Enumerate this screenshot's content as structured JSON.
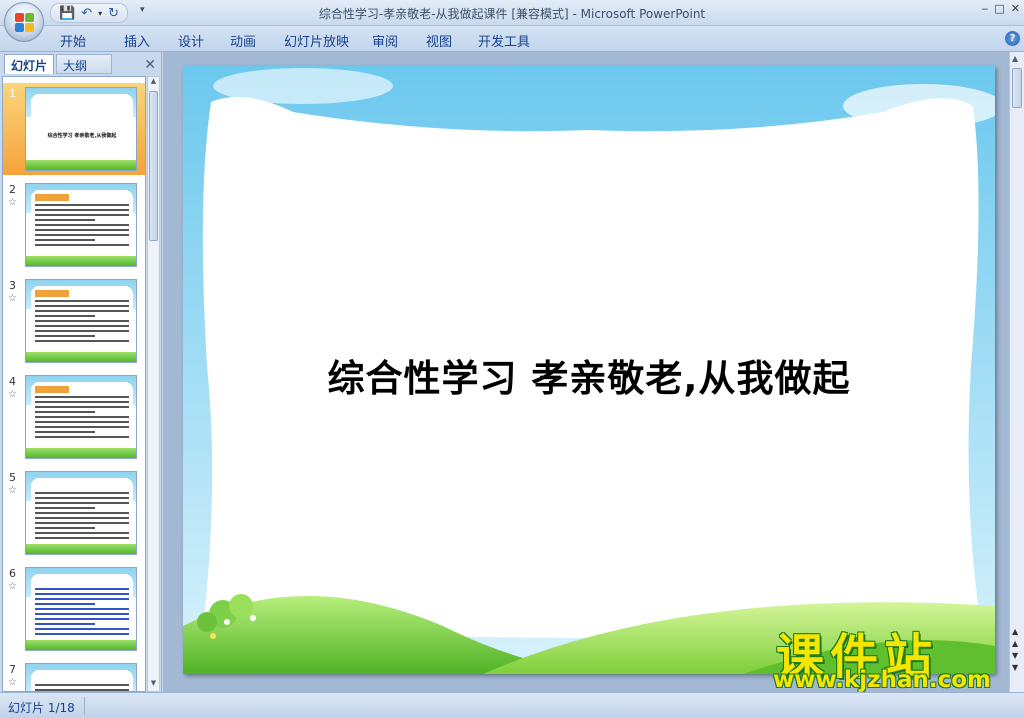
{
  "window": {
    "title": "综合性学习-孝亲敬老-从我做起课件 [兼容模式] - Microsoft PowerPoint",
    "controls": [
      "‒",
      "□",
      "✕"
    ]
  },
  "quick_access": {
    "save_icon": "💾",
    "undo_icon": "↶",
    "dropdown_icon": "▾",
    "redo_icon": "↻",
    "more_icon": "▾"
  },
  "ribbon": {
    "tabs": [
      "开始",
      "插入",
      "设计",
      "动画",
      "幻灯片放映",
      "审阅",
      "视图",
      "开发工具"
    ],
    "help_label": "?"
  },
  "left_pane": {
    "tab_slides": "幻灯片",
    "tab_outline": "大纲",
    "close_label": "✕",
    "slides": [
      {
        "num": "1",
        "star": "",
        "selected": true,
        "kind": "title",
        "title": "综合性学习  孝亲敬老,从我做起"
      },
      {
        "num": "2",
        "star": "☆",
        "selected": false,
        "kind": "text"
      },
      {
        "num": "3",
        "star": "☆",
        "selected": false,
        "kind": "text"
      },
      {
        "num": "4",
        "star": "☆",
        "selected": false,
        "kind": "text"
      },
      {
        "num": "5",
        "star": "☆",
        "selected": false,
        "kind": "plain"
      },
      {
        "num": "6",
        "star": "☆",
        "selected": false,
        "kind": "blue"
      },
      {
        "num": "7",
        "star": "☆",
        "selected": false,
        "kind": "plain"
      }
    ]
  },
  "slide": {
    "title": "综合性学习  孝亲敬老,从我做起"
  },
  "watermark": {
    "cn": "课件站",
    "url": "www.kjzhan.com"
  },
  "status": {
    "slide_indicator": "幻灯片 1/18"
  },
  "colors": {
    "accent": "#15428b",
    "selected_thumb": "#f6a33b",
    "watermark_yellow": "#f5e600",
    "sky": "#8fd3ef",
    "grass": "#55b82c"
  }
}
